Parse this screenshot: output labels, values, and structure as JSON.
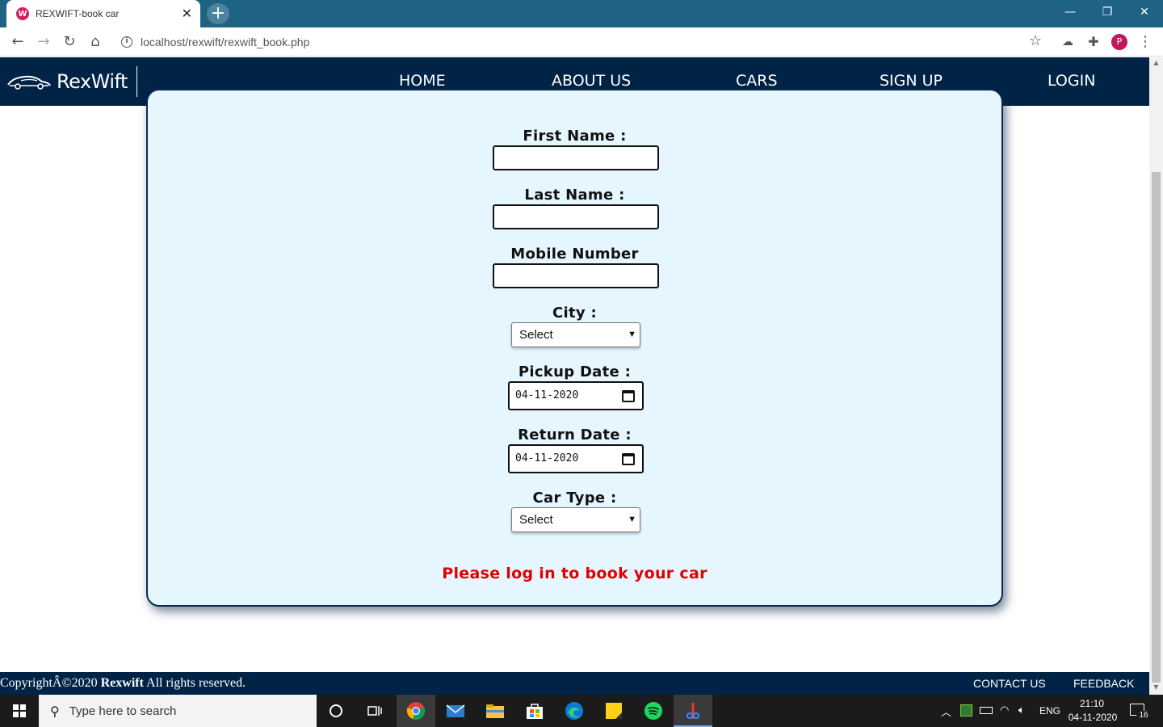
{
  "browser": {
    "tab_title": "REXWIFT-book car",
    "url": "localhost/rexwift/rexwift_book.php",
    "profile_initial": "P"
  },
  "brand": {
    "name": "RexWift"
  },
  "nav": {
    "items": [
      {
        "label": "HOME"
      },
      {
        "label": "ABOUT US"
      },
      {
        "label": "CARS"
      },
      {
        "label": "SIGN UP"
      },
      {
        "label": "LOGIN"
      }
    ]
  },
  "form": {
    "first_name_label": "First Name :",
    "first_name_value": "",
    "last_name_label": "Last Name :",
    "last_name_value": "",
    "mobile_label": "Mobile Number",
    "mobile_value": "",
    "city_label": "City :",
    "city_selected": "Select",
    "pickup_label": "Pickup Date :",
    "pickup_value": "04-11-2020",
    "return_label": "Return Date :",
    "return_value": "04-11-2020",
    "car_type_label": "Car Type :",
    "car_type_selected": "Select",
    "login_message": "Please log in to book your car"
  },
  "footer": {
    "copyright_prefix": "CopyrightÂ©2020",
    "copyright_brand": "Rexwift",
    "copyright_suffix": "All rights reserved.",
    "contact": "CONTACT US",
    "feedback": "FEEDBACK"
  },
  "taskbar": {
    "search_placeholder": "Type here to search",
    "language": "ENG",
    "time": "21:10",
    "date": "04-11-2020",
    "notification_count": "16"
  },
  "colors": {
    "navbar": "#002346",
    "card_bg": "#e6f6ff",
    "error_text": "#e00000",
    "chrome_tabstrip": "#1e6384"
  }
}
